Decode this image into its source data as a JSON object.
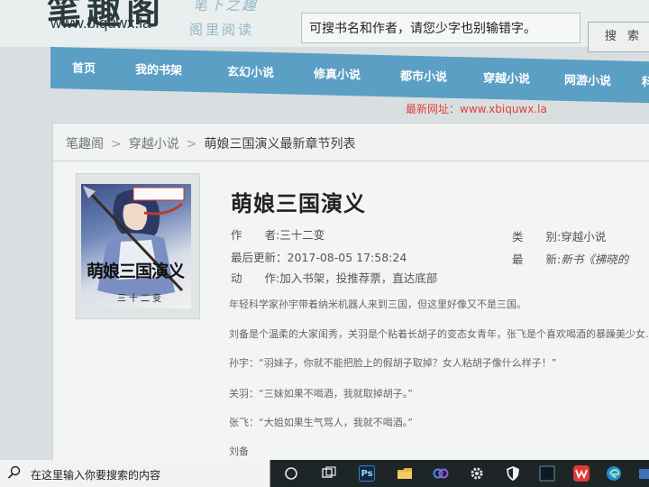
{
  "site": {
    "logo_text": "笔趣阁",
    "logo_url": "www.biquwx.la",
    "slogan_line1": "笔下之趣",
    "slogan_line2": "阁里阅读",
    "search_placeholder": "可搜书名和作者，请您少字也别输错字。",
    "search_button": "搜 索",
    "new_url": "最新网址：www.xbiquwx.la"
  },
  "nav": {
    "items": [
      {
        "label": "首页"
      },
      {
        "label": "我的书架"
      },
      {
        "label": "玄幻小说"
      },
      {
        "label": "修真小说"
      },
      {
        "label": "都市小说"
      },
      {
        "label": "穿越小说"
      },
      {
        "label": "网游小说"
      },
      {
        "label": "科"
      }
    ]
  },
  "breadcrumb": {
    "home": "笔趣阁",
    "category": "穿越小说",
    "current": "萌娘三国演义最新章节列表"
  },
  "book": {
    "title": "萌娘三国演义",
    "cover_title": "萌娘三国演义",
    "cover_author": "三十二变",
    "author_label": "作　　者:",
    "author": "三十二变",
    "category_label": "类　　别:",
    "category": "穿越小说",
    "updated_label": "最后更新：",
    "updated": "2017-08-05 17:58:24",
    "latest_label": "最　　新:",
    "latest": "新书《拂晓的",
    "actions_label": "动　　作:",
    "action_shelf": "加入书架",
    "action_vote": "投推荐票",
    "action_bottom": "直达底部"
  },
  "intro": {
    "lines": [
      "年轻科学家孙宇带着纳米机器人来到三国，但这里好像又不是三国。",
      "刘备是个温柔的大家闺秀，关羽是个粘着长胡子的变态女青年，张飞是个喜欢喝酒的暴躁美少女…",
      "孙宇：“羽妹子，你就不能把脸上的假胡子取掉？女人粘胡子像什么样子！”",
      "关羽：“三妹如果不喝酒，我就取掉胡子。”",
      "张飞：“大姐如果生气骂人，我就不喝酒。”",
      "刘备"
    ]
  },
  "taskbar": {
    "search_text": "在这里输入你要搜索的内容",
    "ps_label": "Ps"
  }
}
